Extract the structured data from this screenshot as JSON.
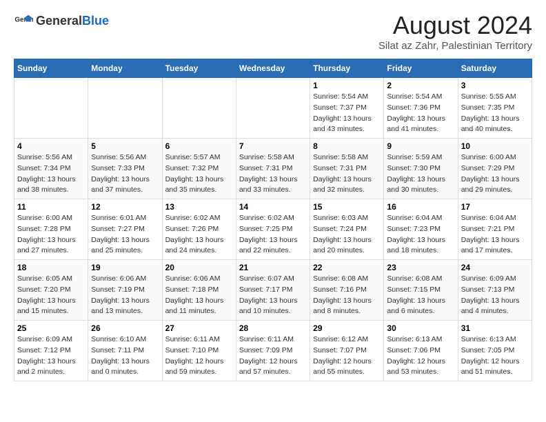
{
  "header": {
    "logo_general": "General",
    "logo_blue": "Blue",
    "main_title": "August 2024",
    "subtitle": "Silat az Zahr, Palestinian Territory"
  },
  "calendar": {
    "days_of_week": [
      "Sunday",
      "Monday",
      "Tuesday",
      "Wednesday",
      "Thursday",
      "Friday",
      "Saturday"
    ],
    "weeks": [
      {
        "cells": [
          {
            "day": "",
            "content": ""
          },
          {
            "day": "",
            "content": ""
          },
          {
            "day": "",
            "content": ""
          },
          {
            "day": "",
            "content": ""
          },
          {
            "day": "1",
            "content": "Sunrise: 5:54 AM\nSunset: 7:37 PM\nDaylight: 13 hours\nand 43 minutes."
          },
          {
            "day": "2",
            "content": "Sunrise: 5:54 AM\nSunset: 7:36 PM\nDaylight: 13 hours\nand 41 minutes."
          },
          {
            "day": "3",
            "content": "Sunrise: 5:55 AM\nSunset: 7:35 PM\nDaylight: 13 hours\nand 40 minutes."
          }
        ]
      },
      {
        "cells": [
          {
            "day": "4",
            "content": "Sunrise: 5:56 AM\nSunset: 7:34 PM\nDaylight: 13 hours\nand 38 minutes."
          },
          {
            "day": "5",
            "content": "Sunrise: 5:56 AM\nSunset: 7:33 PM\nDaylight: 13 hours\nand 37 minutes."
          },
          {
            "day": "6",
            "content": "Sunrise: 5:57 AM\nSunset: 7:32 PM\nDaylight: 13 hours\nand 35 minutes."
          },
          {
            "day": "7",
            "content": "Sunrise: 5:58 AM\nSunset: 7:31 PM\nDaylight: 13 hours\nand 33 minutes."
          },
          {
            "day": "8",
            "content": "Sunrise: 5:58 AM\nSunset: 7:31 PM\nDaylight: 13 hours\nand 32 minutes."
          },
          {
            "day": "9",
            "content": "Sunrise: 5:59 AM\nSunset: 7:30 PM\nDaylight: 13 hours\nand 30 minutes."
          },
          {
            "day": "10",
            "content": "Sunrise: 6:00 AM\nSunset: 7:29 PM\nDaylight: 13 hours\nand 29 minutes."
          }
        ]
      },
      {
        "cells": [
          {
            "day": "11",
            "content": "Sunrise: 6:00 AM\nSunset: 7:28 PM\nDaylight: 13 hours\nand 27 minutes."
          },
          {
            "day": "12",
            "content": "Sunrise: 6:01 AM\nSunset: 7:27 PM\nDaylight: 13 hours\nand 25 minutes."
          },
          {
            "day": "13",
            "content": "Sunrise: 6:02 AM\nSunset: 7:26 PM\nDaylight: 13 hours\nand 24 minutes."
          },
          {
            "day": "14",
            "content": "Sunrise: 6:02 AM\nSunset: 7:25 PM\nDaylight: 13 hours\nand 22 minutes."
          },
          {
            "day": "15",
            "content": "Sunrise: 6:03 AM\nSunset: 7:24 PM\nDaylight: 13 hours\nand 20 minutes."
          },
          {
            "day": "16",
            "content": "Sunrise: 6:04 AM\nSunset: 7:23 PM\nDaylight: 13 hours\nand 18 minutes."
          },
          {
            "day": "17",
            "content": "Sunrise: 6:04 AM\nSunset: 7:21 PM\nDaylight: 13 hours\nand 17 minutes."
          }
        ]
      },
      {
        "cells": [
          {
            "day": "18",
            "content": "Sunrise: 6:05 AM\nSunset: 7:20 PM\nDaylight: 13 hours\nand 15 minutes."
          },
          {
            "day": "19",
            "content": "Sunrise: 6:06 AM\nSunset: 7:19 PM\nDaylight: 13 hours\nand 13 minutes."
          },
          {
            "day": "20",
            "content": "Sunrise: 6:06 AM\nSunset: 7:18 PM\nDaylight: 13 hours\nand 11 minutes."
          },
          {
            "day": "21",
            "content": "Sunrise: 6:07 AM\nSunset: 7:17 PM\nDaylight: 13 hours\nand 10 minutes."
          },
          {
            "day": "22",
            "content": "Sunrise: 6:08 AM\nSunset: 7:16 PM\nDaylight: 13 hours\nand 8 minutes."
          },
          {
            "day": "23",
            "content": "Sunrise: 6:08 AM\nSunset: 7:15 PM\nDaylight: 13 hours\nand 6 minutes."
          },
          {
            "day": "24",
            "content": "Sunrise: 6:09 AM\nSunset: 7:13 PM\nDaylight: 13 hours\nand 4 minutes."
          }
        ]
      },
      {
        "cells": [
          {
            "day": "25",
            "content": "Sunrise: 6:09 AM\nSunset: 7:12 PM\nDaylight: 13 hours\nand 2 minutes."
          },
          {
            "day": "26",
            "content": "Sunrise: 6:10 AM\nSunset: 7:11 PM\nDaylight: 13 hours\nand 0 minutes."
          },
          {
            "day": "27",
            "content": "Sunrise: 6:11 AM\nSunset: 7:10 PM\nDaylight: 12 hours\nand 59 minutes."
          },
          {
            "day": "28",
            "content": "Sunrise: 6:11 AM\nSunset: 7:09 PM\nDaylight: 12 hours\nand 57 minutes."
          },
          {
            "day": "29",
            "content": "Sunrise: 6:12 AM\nSunset: 7:07 PM\nDaylight: 12 hours\nand 55 minutes."
          },
          {
            "day": "30",
            "content": "Sunrise: 6:13 AM\nSunset: 7:06 PM\nDaylight: 12 hours\nand 53 minutes."
          },
          {
            "day": "31",
            "content": "Sunrise: 6:13 AM\nSunset: 7:05 PM\nDaylight: 12 hours\nand 51 minutes."
          }
        ]
      }
    ]
  }
}
